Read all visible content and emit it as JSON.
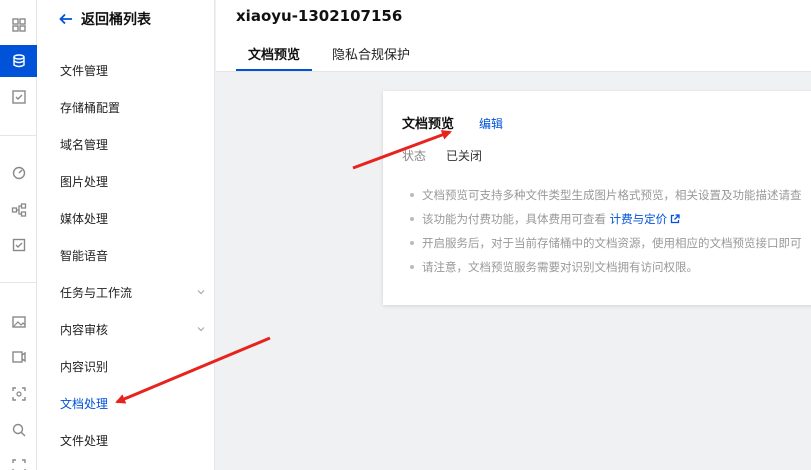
{
  "sidebar": {
    "back_label": "返回桶列表",
    "items": [
      {
        "label": "文件管理",
        "expandable": false
      },
      {
        "label": "存储桶配置",
        "expandable": false
      },
      {
        "label": "域名管理",
        "expandable": false
      },
      {
        "label": "图片处理",
        "expandable": false
      },
      {
        "label": "媒体处理",
        "expandable": false
      },
      {
        "label": "智能语音",
        "expandable": false
      },
      {
        "label": "任务与工作流",
        "expandable": true
      },
      {
        "label": "内容审核",
        "expandable": true
      },
      {
        "label": "内容识别",
        "expandable": false
      },
      {
        "label": "文档处理",
        "expandable": false,
        "active": true
      },
      {
        "label": "文件处理",
        "expandable": false
      }
    ]
  },
  "header": {
    "bucket_name": "xiaoyu-1302107156",
    "tabs": [
      {
        "label": "文档预览",
        "active": true
      },
      {
        "label": "隐私合规保护",
        "active": false
      }
    ]
  },
  "card": {
    "title": "文档预览",
    "edit_label": "编辑",
    "status_label": "状态",
    "status_value": "已关闭",
    "notes": [
      {
        "text": "文档预览可支持多种文件类型生成图片格式预览，相关设置及功能描述请查"
      },
      {
        "text": "该功能为付费功能，具体费用可查看 ",
        "link": "计费与定价"
      },
      {
        "text": "开启服务后，对于当前存储桶中的文档资源，使用相应的文档预览接口即可"
      },
      {
        "text": "请注意，文档预览服务需要对识别文档拥有访问权限。"
      }
    ]
  },
  "colors": {
    "accent": "#0052d9",
    "annotation_arrow": "#e8231d"
  }
}
